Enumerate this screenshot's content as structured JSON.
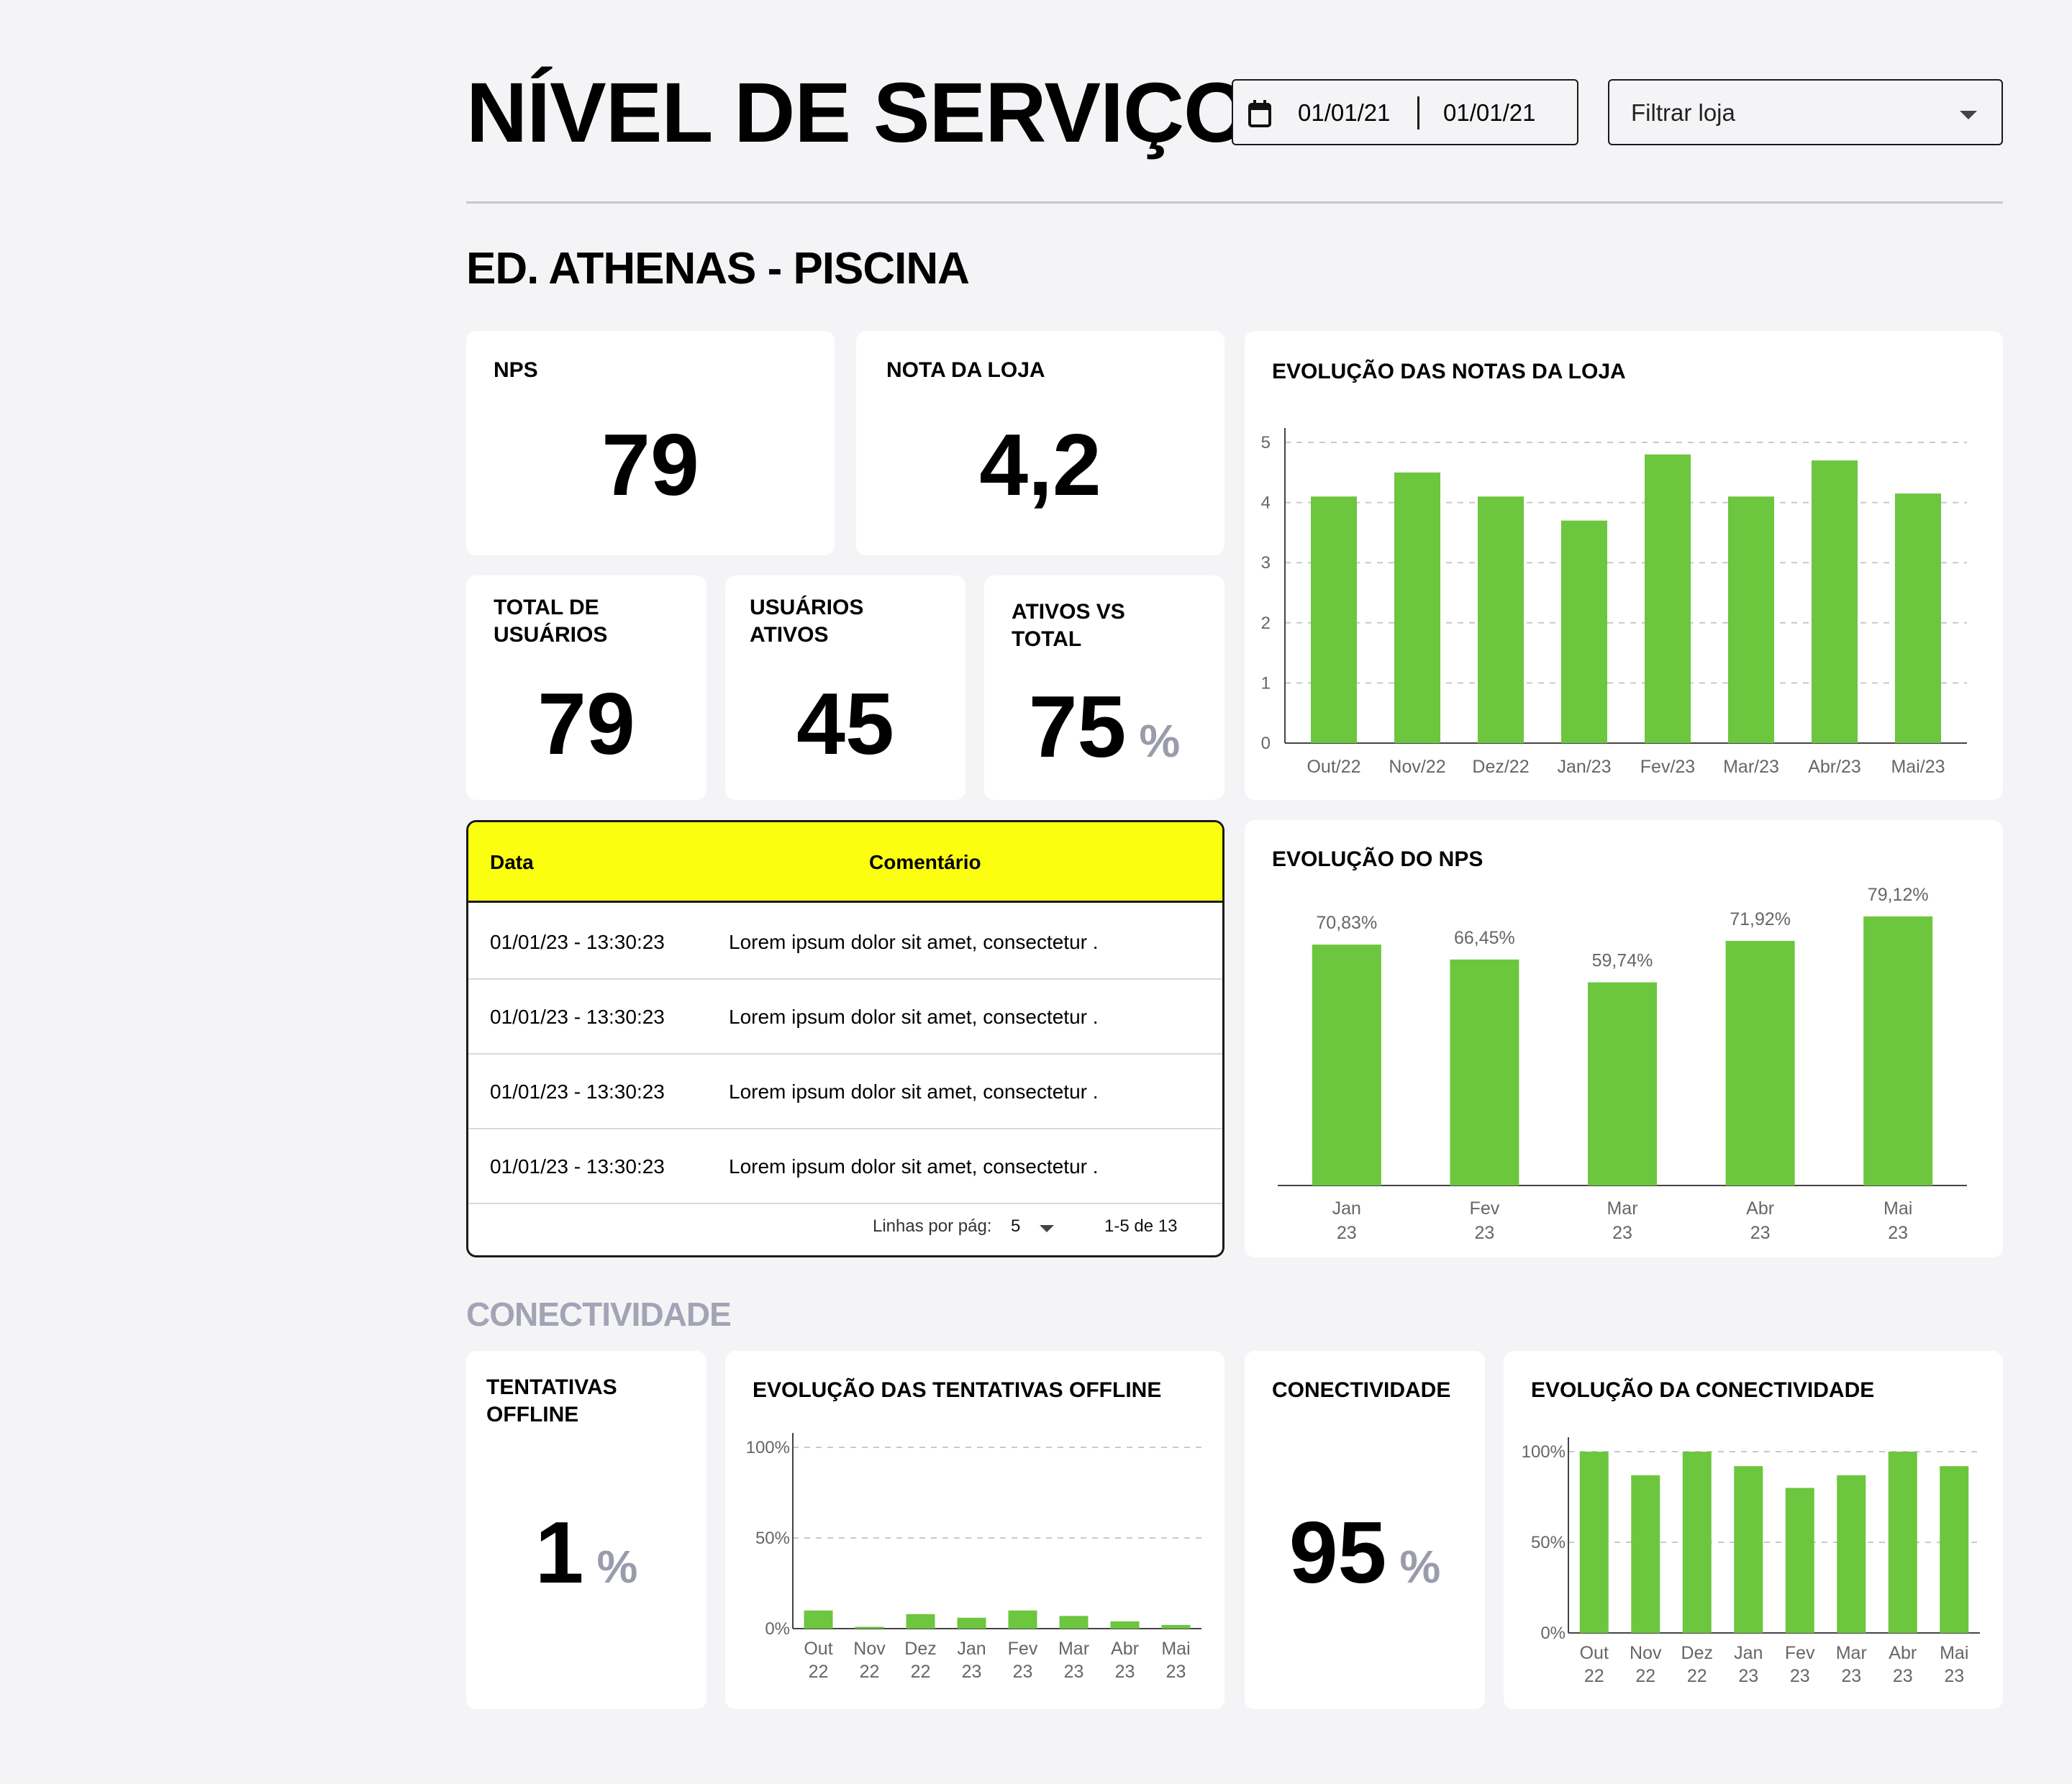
{
  "header": {
    "title": "NÍVEL DE SERVIÇO",
    "date_start": "01/01/21",
    "date_end": "01/01/21",
    "store_filter_placeholder": "Filtrar loja"
  },
  "store_name": "ED. ATHENAS - PISCINA",
  "kpis": {
    "nps_label": "NPS",
    "nps_value": "79",
    "store_rating_label": "NOTA DA LOJA",
    "store_rating_value": "4,2",
    "total_users_label": "TOTAL DE USUÁRIOS",
    "total_users_value": "79",
    "active_users_label": "USUÁRIOS ATIVOS",
    "active_users_value": "45",
    "active_vs_total_label": "ATIVOS VS TOTAL",
    "active_vs_total_value": "75",
    "percent_symbol": "%"
  },
  "comments_table": {
    "columns": [
      "Data",
      "Comentário"
    ],
    "rows": [
      [
        "01/01/23 - 13:30:23",
        "Lorem ipsum dolor sit amet, consectetur ."
      ],
      [
        "01/01/23 - 13:30:23",
        "Lorem ipsum dolor sit amet, consectetur ."
      ],
      [
        "01/01/23 - 13:30:23",
        "Lorem ipsum dolor sit amet, consectetur ."
      ],
      [
        "01/01/23 - 13:30:23",
        "Lorem ipsum dolor sit amet, consectetur ."
      ]
    ],
    "rows_per_page_label": "Linhas por pág:",
    "rows_per_page_value": "5",
    "range_label": "1-5 de 13"
  },
  "connectivity_section": {
    "title": "CONECTIVIDADE",
    "offline_attempts_label": "TENTATIVAS OFFLINE",
    "offline_attempts_value": "1",
    "connectivity_label": "CONECTIVIDADE",
    "connectivity_value": "95"
  },
  "colors": {
    "bar": "#6cc63e",
    "table_header": "#fbff0f",
    "muted": "#9a9cab"
  },
  "chart_data": [
    {
      "id": "store_ratings",
      "type": "bar",
      "title": "EVOLUÇÃO DAS NOTAS DA LOJA",
      "categories": [
        "Out/22",
        "Nov/22",
        "Dez/22",
        "Jan/23",
        "Fev/23",
        "Mar/23",
        "Abr/23",
        "Mai/23"
      ],
      "values": [
        4.1,
        4.5,
        4.1,
        3.7,
        4.8,
        4.1,
        4.7,
        4.15
      ],
      "ylim": [
        0,
        5
      ],
      "yticks": [
        "0",
        "1",
        "2",
        "3",
        "4",
        "5"
      ],
      "grid": true
    },
    {
      "id": "nps_evolution",
      "type": "bar",
      "title": "EVOLUÇÃO DO NPS",
      "categories": [
        [
          "Jan",
          "23"
        ],
        [
          "Fev",
          "23"
        ],
        [
          "Mar",
          "23"
        ],
        [
          "Abr",
          "23"
        ],
        [
          "Mai",
          "23"
        ]
      ],
      "values": [
        70.83,
        66.45,
        59.74,
        71.92,
        79.12
      ],
      "data_labels": [
        "70,83%",
        "66,45%",
        "59,74%",
        "71,92%",
        "79,12%"
      ],
      "grid": false
    },
    {
      "id": "offline_attempts",
      "type": "bar",
      "title": "EVOLUÇÃO DAS TENTATIVAS OFFLINE",
      "categories": [
        [
          "Out",
          "22"
        ],
        [
          "Nov",
          "22"
        ],
        [
          "Dez",
          "22"
        ],
        [
          "Jan",
          "23"
        ],
        [
          "Fev",
          "23"
        ],
        [
          "Mar",
          "23"
        ],
        [
          "Abr",
          "23"
        ],
        [
          "Mai",
          "23"
        ]
      ],
      "values": [
        10,
        1,
        8,
        6,
        10,
        7,
        4,
        2
      ],
      "ylim": [
        0,
        100
      ],
      "yticks": [
        "0%",
        "50%",
        "100%"
      ],
      "grid": true
    },
    {
      "id": "connectivity_evolution",
      "type": "bar",
      "title": "EVOLUÇÃO  DA CONECTIVIDADE",
      "categories": [
        [
          "Out",
          "22"
        ],
        [
          "Nov",
          "22"
        ],
        [
          "Dez",
          "22"
        ],
        [
          "Jan",
          "23"
        ],
        [
          "Fev",
          "23"
        ],
        [
          "Mar",
          "23"
        ],
        [
          "Abr",
          "23"
        ],
        [
          "Mai",
          "23"
        ]
      ],
      "values": [
        100,
        87,
        100,
        92,
        80,
        87,
        100,
        92
      ],
      "ylim": [
        0,
        100
      ],
      "yticks": [
        "0%",
        "50%",
        "100%"
      ],
      "grid": true
    }
  ]
}
